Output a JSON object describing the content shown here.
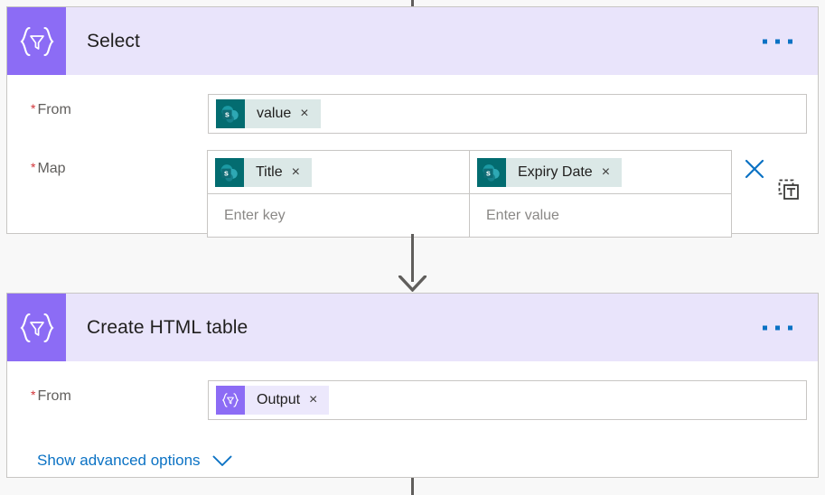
{
  "theme": {
    "canvas_bg": "#f8f8f8",
    "card_bg": "#ffffff",
    "card_border": "#c8c6c4",
    "header_bg": "#e9e4fb",
    "accent_purple": "#8c6cf5",
    "accent_blue": "#0b72c4",
    "required_red": "#d13438",
    "sharepoint_teal": "#036c70",
    "token_sp_bg": "#dbe8e7",
    "token_purple_bg": "#ece8fc",
    "connector_gray": "#605e5c"
  },
  "connectors": {
    "top_stub": "vertical-connector-line",
    "middle": "vertical-connector-arrow",
    "bottom_stub": "vertical-connector-line"
  },
  "cards": [
    {
      "id": "select",
      "title": "Select",
      "icon": "data-operation-braces-icon",
      "menu": "ellipsis-menu",
      "fields": [
        {
          "id": "from",
          "label": "From",
          "required": true,
          "required_marker": "*",
          "tokens": [
            {
              "label": "value",
              "icon": "sharepoint-icon",
              "kind": "sharepoint",
              "remove": "×"
            }
          ]
        },
        {
          "id": "map",
          "label": "Map",
          "required": true,
          "required_marker": "*",
          "grid": {
            "row1": {
              "key": {
                "tokens": [
                  {
                    "label": "Title",
                    "icon": "sharepoint-icon",
                    "kind": "sharepoint",
                    "remove": "×"
                  }
                ]
              },
              "value": {
                "tokens": [
                  {
                    "label": "Expiry Date",
                    "icon": "sharepoint-icon",
                    "kind": "sharepoint",
                    "remove": "×"
                  }
                ]
              }
            },
            "row2": {
              "key": {
                "placeholder": "Enter key"
              },
              "value": {
                "placeholder": "Enter value"
              }
            }
          },
          "actions": [
            {
              "id": "delete-map-row",
              "icon": "close-x-icon",
              "label": "Delete"
            },
            {
              "id": "switch-text-mode",
              "icon": "text-mode-icon",
              "label": "Switch to text mode"
            }
          ]
        }
      ]
    },
    {
      "id": "create-html-table",
      "title": "Create HTML table",
      "icon": "data-operation-braces-icon",
      "menu": "ellipsis-menu",
      "fields": [
        {
          "id": "from",
          "label": "From",
          "required": true,
          "required_marker": "*",
          "tokens": [
            {
              "label": "Output",
              "icon": "data-operation-braces-icon",
              "kind": "purple",
              "remove": "×"
            }
          ]
        }
      ],
      "advanced": {
        "label": "Show advanced options",
        "icon": "chevron-down-icon"
      }
    }
  ]
}
